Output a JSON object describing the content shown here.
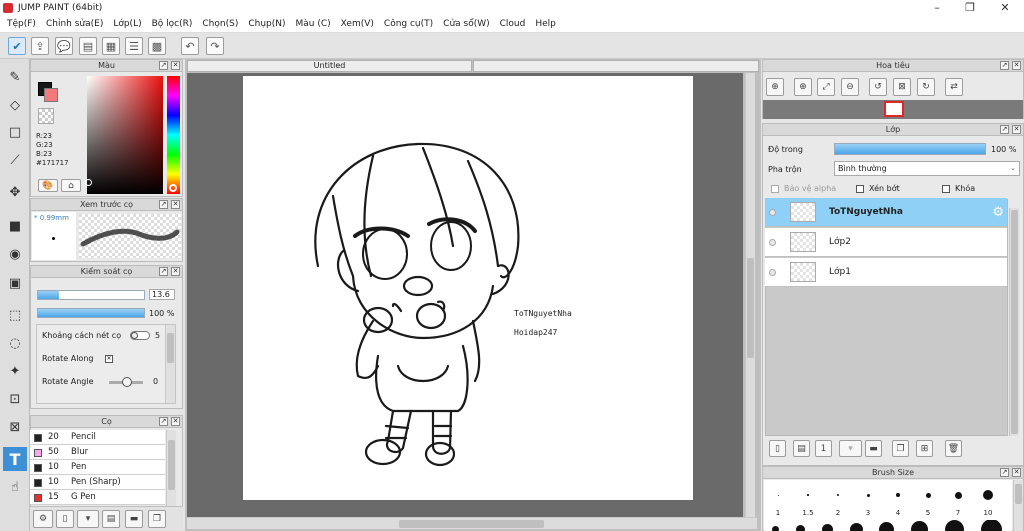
{
  "window": {
    "title": "JUMP PAINT (64bit)"
  },
  "menu": [
    "Tệp(F)",
    "Chỉnh sửa(E)",
    "Lớp(L)",
    "Bộ lọc(R)",
    "Chọn(S)",
    "Chụp(N)",
    "Màu (C)",
    "Xem(V)",
    "Công cụ(T)",
    "Cửa sổ(W)",
    "Cloud",
    "Help"
  ],
  "colorPanel": {
    "title": "Màu",
    "r": "R:23",
    "g": "G:23",
    "b": "B:23",
    "hex": "#171717",
    "mainColor": "#171717",
    "subColor": "#f27a7a"
  },
  "previewPanel": {
    "title": "Xem trước cọ",
    "size": "* 0.99mm"
  },
  "brushControl": {
    "title": "Kiểm soát cọ",
    "sizeValue": "13.6",
    "sizeFill": 0.2,
    "opacityValue": "100 %",
    "opacityFill": 1.0,
    "spacingLabel": "Khoảng cách nét cọ",
    "spacingValue": "5",
    "rotateAlongLabel": "Rotate Along",
    "rotateAngleLabel": "Rotate Angle",
    "rotateAngleValue": "0"
  },
  "brushPanel": {
    "title": "Cọ",
    "brushes": [
      {
        "size": "20",
        "name": "Pencil",
        "color": "#222222"
      },
      {
        "size": "50",
        "name": "Blur",
        "color": "#f7a8f0"
      },
      {
        "size": "10",
        "name": "Pen",
        "color": "#222222"
      },
      {
        "size": "10",
        "name": "Pen (Sharp)",
        "color": "#222222"
      },
      {
        "size": "15",
        "name": "G Pen",
        "color": "#e83030"
      }
    ]
  },
  "document": {
    "tabTitle": "Untitled",
    "watermark1": "ToTNguyetNha",
    "watermark2": "Hoidap247"
  },
  "navigator": {
    "title": "Hoa tiêu"
  },
  "layerPanel": {
    "title": "Lớp",
    "opacityLabel": "Độ trong",
    "opacityValue": "100 %",
    "blendLabel": "Pha trộn",
    "blendValue": "Bình thường",
    "protectAlpha": "Bảo vệ alpha",
    "clipping": "Xén bớt",
    "lock": "Khóa",
    "layers": [
      {
        "name": "ToTNguyetNha",
        "selected": true
      },
      {
        "name": "Lớp2",
        "selected": false
      },
      {
        "name": "Lớp1",
        "selected": false
      }
    ]
  },
  "brushSizePanel": {
    "title": "Brush Size",
    "sizes": [
      "1",
      "1.5",
      "2",
      "3",
      "4",
      "5",
      "7",
      "10"
    ]
  }
}
